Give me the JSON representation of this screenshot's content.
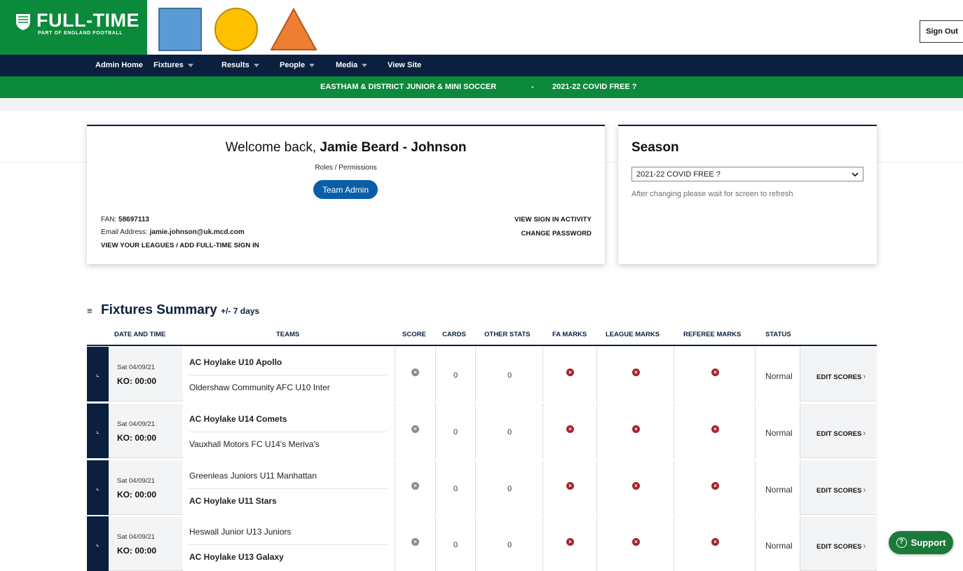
{
  "brand": {
    "name": "FULL-TIME",
    "tagline": "PART OF ENGLAND FOOTBALL"
  },
  "header": {
    "sign_out": "Sign Out"
  },
  "nav": {
    "items": [
      {
        "label": "Admin Home",
        "has_caret": false
      },
      {
        "label": "Fixtures",
        "has_caret": true
      },
      {
        "label": "Results",
        "has_caret": true
      },
      {
        "label": "People",
        "has_caret": true
      },
      {
        "label": "Media",
        "has_caret": true
      },
      {
        "label": "View Site",
        "has_caret": false
      }
    ]
  },
  "league_bar": {
    "league": "EASTHAM & DISTRICT JUNIOR & MINI SOCCER",
    "separator": "-",
    "season": "2021-22 COVID FREE ?"
  },
  "welcome": {
    "greeting": "Welcome back,",
    "user_name": "Jamie Beard - Johnson",
    "roles_label": "Roles / Permissions",
    "role_button": "Team Admin",
    "fan_label": "FAN:",
    "fan_value": "58697113",
    "email_label": "Email Address:",
    "email_value": "jamie.johnson@uk.mcd.com",
    "view_leagues": "VIEW YOUR LEAGUES / ADD FULL-TIME SIGN IN",
    "view_sign_in": "VIEW SIGN IN ACTIVITY",
    "change_password": "CHANGE PASSWORD"
  },
  "season": {
    "title": "Season",
    "selected": "2021-22 COVID FREE ?",
    "help": "After changing please wait for screen to refresh"
  },
  "fixtures": {
    "title": "Fixtures Summary",
    "subtitle": "+/- 7 days",
    "columns": {
      "date": "DATE AND TIME",
      "teams": "TEAMS",
      "score": "SCORE",
      "cards": "CARDS",
      "other": "OTHER STATS",
      "fa": "FA MARKS",
      "league": "LEAGUE MARKS",
      "referee": "REFEREE MARKS",
      "status": "STATUS"
    },
    "rows": [
      {
        "date": "Sat 04/09/21",
        "ko": "KO: 00:00",
        "home": "AC Hoylake U10 Apollo",
        "away": "Oldershaw Community AFC U10 Inter",
        "bold_team": "home",
        "cards": "0",
        "other": "0",
        "status": "Normal",
        "action": "EDIT SCORES"
      },
      {
        "date": "Sat 04/09/21",
        "ko": "KO: 00:00",
        "home": "AC Hoylake U14 Comets",
        "away": "Vauxhall Motors FC U14's Meriva's",
        "bold_team": "home",
        "cards": "0",
        "other": "0",
        "status": "Normal",
        "action": "EDIT SCORES"
      },
      {
        "date": "Sat 04/09/21",
        "ko": "KO: 00:00",
        "home": "Greenleas Juniors U11 Manhattan",
        "away": "AC Hoylake U11 Stars",
        "bold_team": "away",
        "cards": "0",
        "other": "0",
        "status": "Normal",
        "action": "EDIT SCORES"
      },
      {
        "date": "Sat 04/09/21",
        "ko": "KO: 00:00",
        "home": "Heswall Junior U13 Juniors",
        "away": "AC Hoylake U13 Galaxy",
        "bold_team": "away",
        "cards": "0",
        "other": "0",
        "status": "Normal",
        "action": "EDIT SCORES"
      }
    ]
  },
  "support": {
    "label": "Support"
  },
  "colors": {
    "brand_green": "#0a8a3a",
    "navy": "#0b1f3f",
    "button_blue": "#0a5ea8",
    "mark_red": "#a3242a"
  }
}
